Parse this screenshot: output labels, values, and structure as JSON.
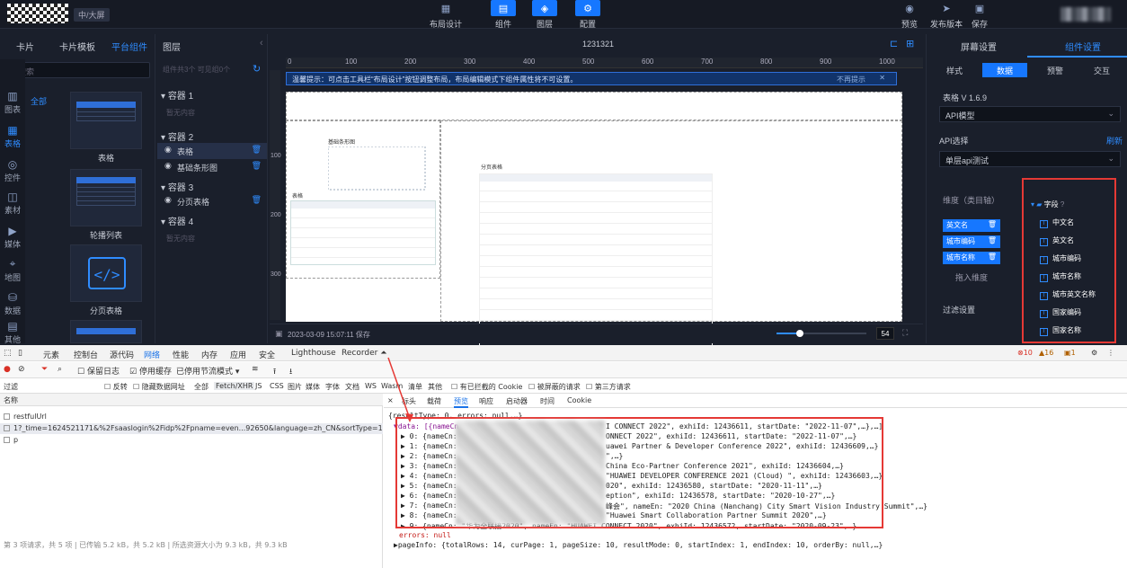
{
  "topbar": {
    "screen_tag": "中/大屏",
    "layout_btn": "布局设计",
    "component_btn": "组件",
    "layer_btn": "图层",
    "config_btn": "配置",
    "preview_btn": "预览",
    "publish_btn": "发布版本",
    "save_btn": "保存"
  },
  "rail": [
    "图表",
    "表格",
    "控件",
    "素材",
    "媒体",
    "地图",
    "数据",
    "其他"
  ],
  "comp_panel": {
    "tabs": [
      "卡片",
      "卡片模板",
      "平台组件"
    ],
    "search_placeholder": "搜索",
    "category_all": "全部",
    "items": [
      "表格",
      "轮播列表",
      "分页表格"
    ]
  },
  "layers": {
    "title": "图层",
    "counts": "组件共3个   可见组0个",
    "groups": [
      {
        "name": "容器 1",
        "children": [],
        "empty": "暂无内容"
      },
      {
        "name": "容器 2",
        "children": [
          "表格",
          "基础条形图"
        ]
      },
      {
        "name": "容器 3",
        "children": [
          "分页表格"
        ]
      },
      {
        "name": "容器 4",
        "children": [],
        "empty": "暂无内容"
      }
    ]
  },
  "canvas": {
    "title": "1231321",
    "ruler": [
      "0",
      "100",
      "200",
      "300",
      "400",
      "500",
      "600",
      "700",
      "800",
      "900",
      "1000"
    ],
    "vruler": [
      "100",
      "200",
      "300"
    ],
    "hint": "温馨提示：可点击工具栏“布局设计”按钮调整布局，布局编辑模式下组件属性将不可设置。",
    "hint_nope": "不再提示",
    "bar_chart_title": "基础条形图",
    "table_title": "表格",
    "paged_table_title": "分页表格",
    "status": "2023-03-09 15:07:11 保存",
    "zoom": "54",
    "zoom_fraction": 0.26
  },
  "rpanel": {
    "tabs": [
      "屏幕设置",
      "组件设置"
    ],
    "sub_tabs": [
      "样式",
      "数据",
      "预警",
      "交互"
    ],
    "version": "表格   V 1.6.9",
    "model": "API模型",
    "api_label": "API选择",
    "refresh": "刷新",
    "api_value": "单层api测试",
    "dim_label": "维度（类目轴）",
    "dims": [
      "英文名",
      "城市编码",
      "城市名称"
    ],
    "drag_dim": "拖入维度",
    "filter_label": "过滤设置",
    "field_root": "字段",
    "fields": [
      "中文名",
      "英文名",
      "城市编码",
      "城市名称",
      "城市英文名称",
      "国家编码",
      "国家名称"
    ]
  },
  "devtools": {
    "tabs": [
      "元素",
      "控制台",
      "源代码",
      "网络",
      "性能",
      "内存",
      "应用",
      "安全",
      "Lighthouse",
      "Recorder ⏶"
    ],
    "errors": "10",
    "warnings": "16",
    "infos": "1",
    "tool": [
      "保留日志",
      "停用缓存",
      "已停用节流模式"
    ],
    "filter_label": "过滤",
    "filter_chips": [
      "反转",
      "隐藏数据网址",
      "全部",
      "Fetch/XHR",
      "JS",
      "CSS",
      "图片",
      "媒体",
      "字体",
      "文档",
      "WS",
      "Wasm",
      "清单",
      "其他",
      "有已拦截的 Cookie",
      "被屏蔽的请求",
      "第三方请求"
    ],
    "names_header": "名称",
    "requests": [
      "restfulUrl",
      "1?_time=1624521171&%2Fsaaslogin%2Fidp%2Fpname=even...92650&language=zh_CN&sortType=1&keyWord=...",
      "p"
    ],
    "footer": "第 3 项请求，共 5 项 | 已传输 5.2 kB，共 5.2 kB | 所选资源大小为 9.3 kB，共 9.3 kB",
    "detail_tabs": [
      "×",
      "标头",
      "载荷",
      "预览",
      "响应",
      "启动器",
      "时间",
      "Cookie"
    ],
    "preview": {
      "l0": "{resultType: 0, errors: null,…}",
      "l1": "▼data: [{nameCn",
      "l1r": "I CONNECT 2022\", exhiId: 12436611, startDate: \"2022-11-07\",…},…]",
      "rows": [
        [
          "▶ 0: {nameCn:",
          "ONNECT 2022\", exhiId: 12436611, startDate: \"2022-11-07\",…}"
        ],
        [
          "▶ 1: {nameCn:",
          "uawei Partner & Developer Conference 2022\", exhiId: 12436609,…}"
        ],
        [
          "▶ 2: {nameCn:",
          "\",…}"
        ],
        [
          "▶ 3: {nameCn:",
          "China Eco-Partner Conference 2021\", exhiId: 12436604,…}"
        ],
        [
          "▶ 4: {nameCn:",
          "\"HUAWEI DEVELOPER CONFERENCE 2021 (Cloud) \", exhiId: 12436603,…}"
        ],
        [
          "▶ 5: {nameCn:",
          "020\", exhiId: 12436580, startDate: \"2020-11-11\",…}"
        ],
        [
          "▶ 6: {nameCn:",
          "eption\", exhiId: 12436578, startDate: \"2020-10-27\",…}"
        ],
        [
          "▶ 7: {nameCn:",
          "峰会\", nameEn: \"2020 China (Nanchang) City Smart Vision Industry Summit\",…}"
        ],
        [
          "▶ 8: {nameCn:",
          "\"Huawei Smart Collaboration Partner Summit 2020\",…}"
        ],
        [
          "▶ 9: {nameCn: \"华为全联接2020\", nameEn: \"HUAWEI CONNECT 2020\", exhiId: 12436572, startDate: \"2020-09-23\",…}",
          ""
        ]
      ],
      "errors": "errors: null",
      "pageinfo": "▶pageInfo: {totalRows: 14, curPage: 1, pageSize: 10, resultMode: 0, startIndex: 1, endIndex: 10, orderBy: null,…}"
    }
  },
  "colors": {
    "accent": "#1677ff",
    "highlight": "#e53935",
    "panel": "#1a1f2b"
  }
}
